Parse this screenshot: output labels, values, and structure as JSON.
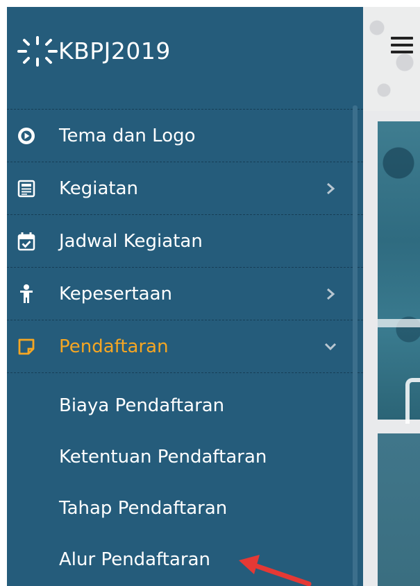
{
  "brand": {
    "name": "KBPJ2019"
  },
  "menu": [
    {
      "label": "Tema dan Logo",
      "icon": "play-circle-icon",
      "has_children": false
    },
    {
      "label": "Kegiatan",
      "icon": "newspaper-icon",
      "has_children": true
    },
    {
      "label": "Jadwal Kegiatan",
      "icon": "calendar-check-icon",
      "has_children": false
    },
    {
      "label": "Kepesertaan",
      "icon": "person-icon",
      "has_children": true
    },
    {
      "label": "Pendaftaran",
      "icon": "sticky-note-icon",
      "has_children": true,
      "expanded": true
    }
  ],
  "submenu": [
    {
      "label": "Biaya Pendaftaran"
    },
    {
      "label": "Ketentuan Pendaftaran"
    },
    {
      "label": "Tahap Pendaftaran"
    },
    {
      "label": "Alur Pendaftaran"
    }
  ],
  "colors": {
    "sidebar_bg": "#255c7b",
    "active_text": "#f5a623",
    "text": "#ffffff",
    "annotation_arrow": "#e53935"
  }
}
